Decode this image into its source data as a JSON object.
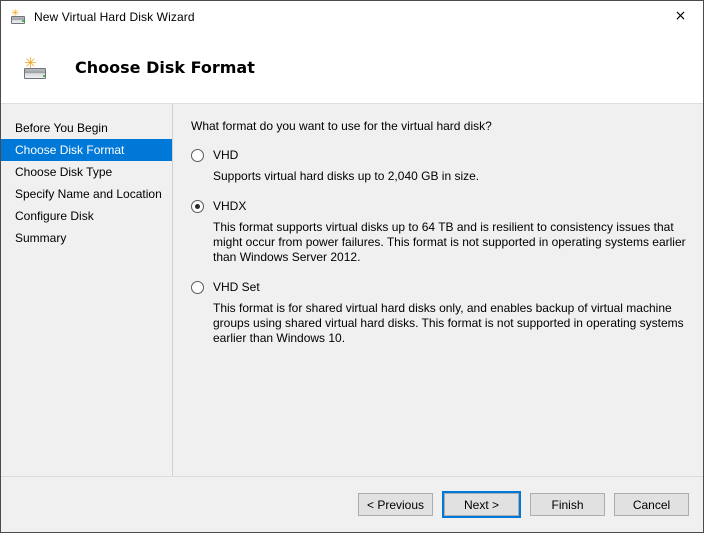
{
  "window": {
    "title": "New Virtual Hard Disk Wizard",
    "title_icon": "virtual-hard-disk-icon",
    "close_label": "×",
    "accent_color": "#0078d7"
  },
  "header": {
    "title": "Choose Disk Format",
    "icon": "virtual-hard-disk-icon"
  },
  "sidebar": {
    "items": [
      {
        "label": "Before You Begin",
        "active": false
      },
      {
        "label": "Choose Disk Format",
        "active": true
      },
      {
        "label": "Choose Disk Type",
        "active": false
      },
      {
        "label": "Specify Name and Location",
        "active": false
      },
      {
        "label": "Configure Disk",
        "active": false
      },
      {
        "label": "Summary",
        "active": false
      }
    ]
  },
  "content": {
    "question": "What format do you want to use for the virtual hard disk?",
    "options": [
      {
        "label": "VHD",
        "selected": false,
        "description": "Supports virtual hard disks up to 2,040 GB in size."
      },
      {
        "label": "VHDX",
        "selected": true,
        "description": "This format supports virtual disks up to 64 TB and is resilient to consistency issues that might occur from power failures. This format is not supported in operating systems earlier than Windows Server 2012."
      },
      {
        "label": "VHD Set",
        "selected": false,
        "description": "This format is for shared virtual hard disks only, and enables backup of virtual machine groups using shared virtual hard disks. This format is not supported in operating systems earlier than Windows 10."
      }
    ]
  },
  "footer": {
    "previous_label": "< Previous",
    "next_label": "Next >",
    "finish_label": "Finish",
    "cancel_label": "Cancel"
  }
}
